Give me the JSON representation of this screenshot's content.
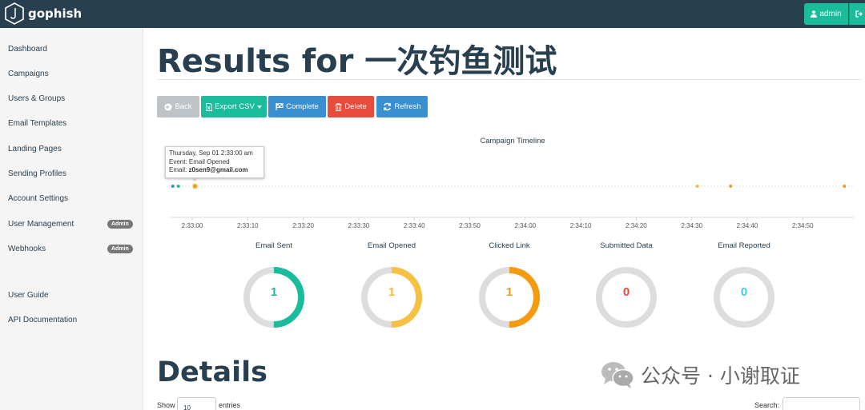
{
  "app": {
    "name": "gophish"
  },
  "header": {
    "admin_label": "admin"
  },
  "sidebar": {
    "items": [
      {
        "label": "Dashboard"
      },
      {
        "label": "Campaigns"
      },
      {
        "label": "Users & Groups"
      },
      {
        "label": "Email Templates"
      },
      {
        "label": "Landing Pages"
      },
      {
        "label": "Sending Profiles"
      },
      {
        "label": "Account Settings"
      },
      {
        "label": "User Management",
        "badge": "Admin"
      },
      {
        "label": "Webhooks",
        "badge": "Admin"
      },
      {
        "label": "User Guide"
      },
      {
        "label": "API Documentation"
      }
    ]
  },
  "page": {
    "title": "Results for 一次钓鱼测试"
  },
  "toolbar": {
    "back": "Back",
    "export": "Export CSV",
    "complete": "Complete",
    "delete": "Delete",
    "refresh": "Refresh"
  },
  "timeline": {
    "title": "Campaign Timeline",
    "tooltip": {
      "date": "Thursday, Sep 01 2:33:00 am",
      "event": "Event: Email Opened",
      "email_prefix": "Email:",
      "email": "z0sen9@gmail.com"
    },
    "ticks": [
      "2:33:00",
      "2:33:10",
      "2:33:20",
      "2:33:30",
      "2:33:40",
      "2:33:50",
      "2:34:00",
      "2:34:10",
      "2:34:20",
      "2:34:30",
      "2:34:40",
      "2:34:50"
    ],
    "events": [
      {
        "t": -3.5,
        "color": "#3a8fd0"
      },
      {
        "t": -2.5,
        "color": "#1abc9c"
      },
      {
        "t": 0.5,
        "color": "#f39c12",
        "highlight": true
      },
      {
        "t": 91,
        "color": "#f6b93b"
      },
      {
        "t": 97,
        "color": "#f39c12"
      },
      {
        "t": 117.5,
        "color": "#f39c12"
      }
    ]
  },
  "stats": [
    {
      "label": "Email Sent",
      "value": "1",
      "fraction": 0.5,
      "color": "#1abc9c",
      "text_color": "#1abc9c"
    },
    {
      "label": "Email Opened",
      "value": "1",
      "fraction": 0.5,
      "color": "#f6c142",
      "text_color": "#f6b93b"
    },
    {
      "label": "Clicked Link",
      "value": "1",
      "fraction": 0.5,
      "color": "#f39c12",
      "text_color": "#f39c12"
    },
    {
      "label": "Submitted Data",
      "value": "0",
      "fraction": 0,
      "color": "#e74c3c",
      "text_color": "#e74c3c"
    },
    {
      "label": "Email Reported",
      "value": "0",
      "fraction": 0,
      "color": "#3fc9e8",
      "text_color": "#3fc9e8"
    }
  ],
  "details": {
    "title": "Details",
    "show": "Show",
    "entries_value": "10",
    "entries": "entries",
    "search_label": "Search:"
  },
  "watermark": {
    "text": "公众号 · 小谢取证"
  }
}
